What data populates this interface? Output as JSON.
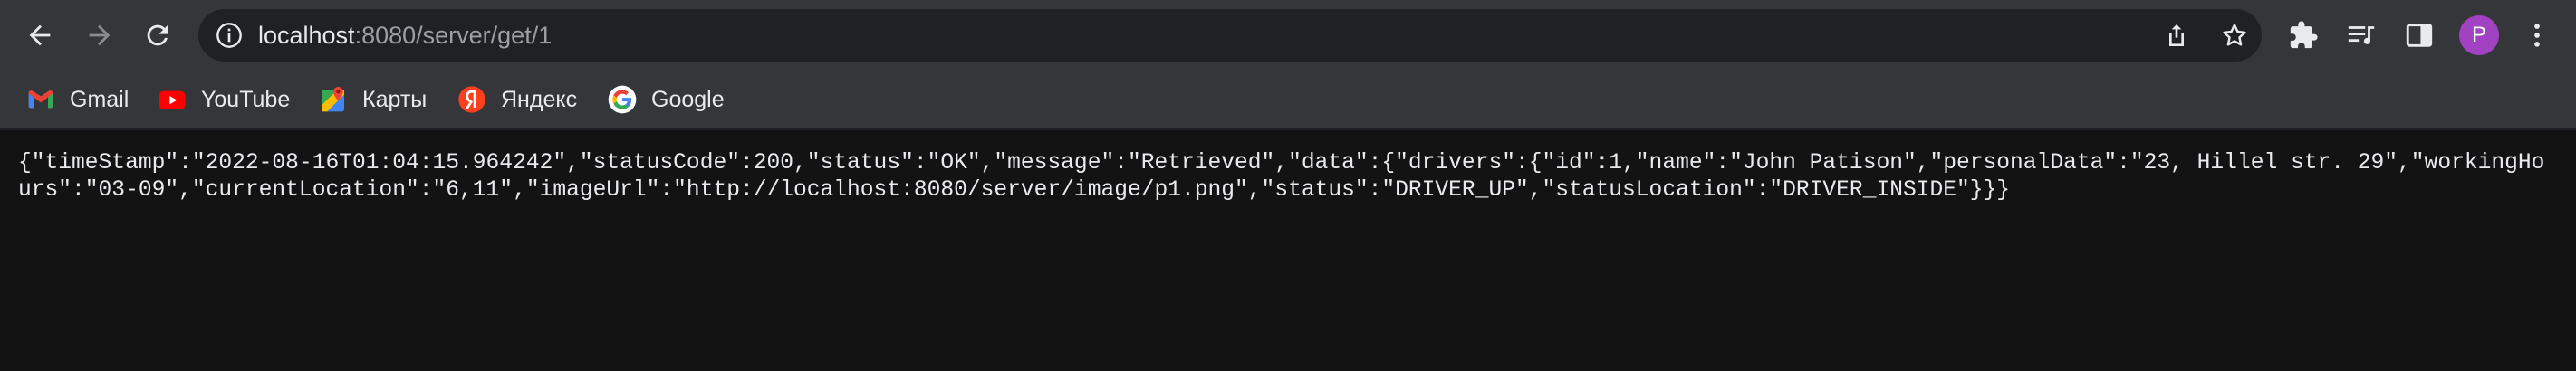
{
  "browser": {
    "url_host": "localhost",
    "url_path": ":8080/server/get/1",
    "profile_initial": "P",
    "accent_color": "#a142c2"
  },
  "bookmarks": [
    {
      "label": "Gmail",
      "icon": "gmail-icon"
    },
    {
      "label": "YouTube",
      "icon": "youtube-icon"
    },
    {
      "label": "Карты",
      "icon": "maps-icon"
    },
    {
      "label": "Яндекс",
      "icon": "yandex-icon"
    },
    {
      "label": "Google",
      "icon": "google-icon"
    }
  ],
  "page": {
    "json_text": "{\"timeStamp\":\"2022-08-16T01:04:15.964242\",\"statusCode\":200,\"status\":\"OK\",\"message\":\"Retrieved\",\"data\":{\"drivers\":{\"id\":1,\"name\":\"John Patison\",\"personalData\":\"23, Hillel str. 29\",\"workingHours\":\"03-09\",\"currentLocation\":\"6,11\",\"imageUrl\":\"http://localhost:8080/server/image/p1.png\",\"status\":\"DRIVER_UP\",\"statusLocation\":\"DRIVER_INSIDE\"}}}"
  }
}
